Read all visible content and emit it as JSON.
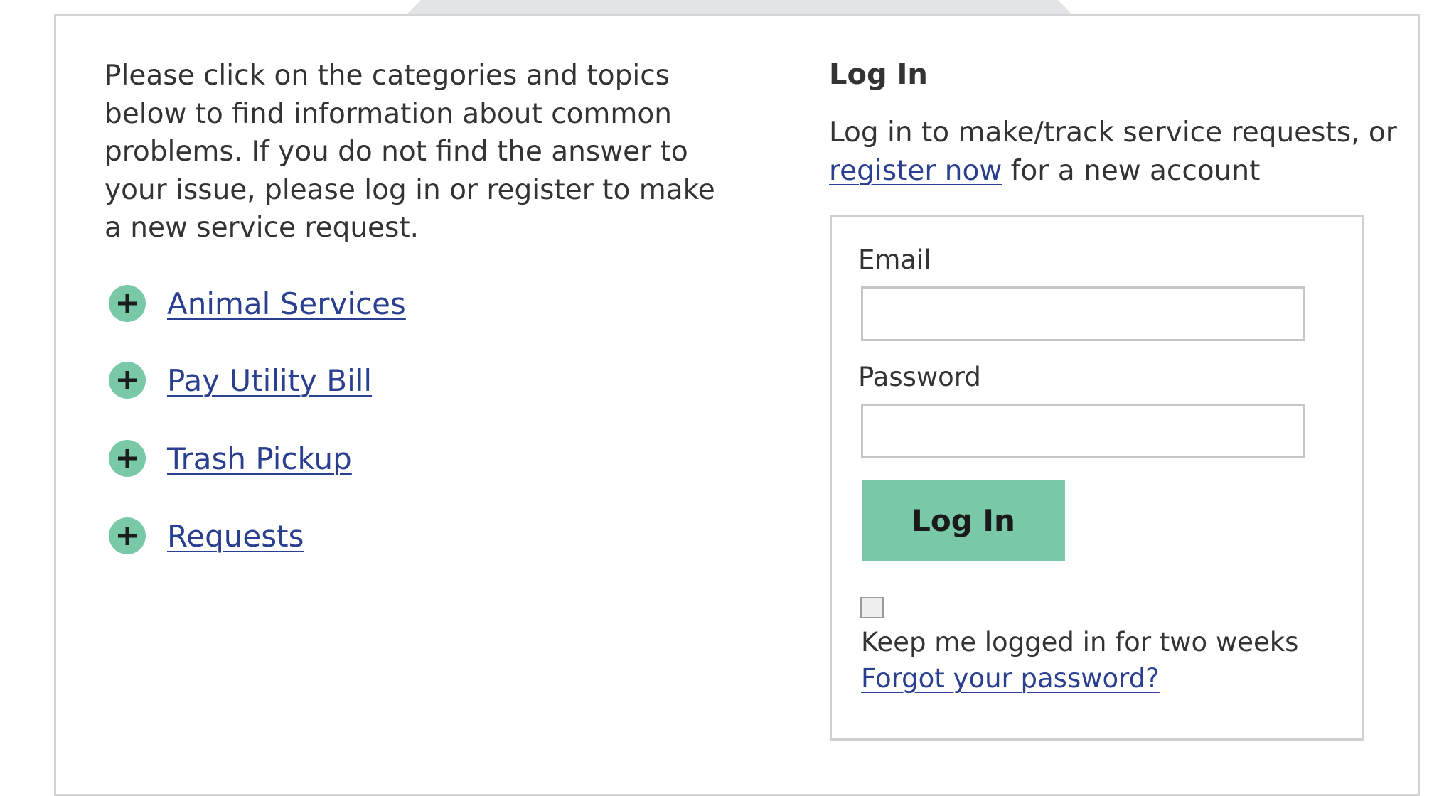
{
  "intro": {
    "text": "Please click on the categories and topics below to find information about common problems. If you do not find the answer to your issue, please log in or register to make a new service request."
  },
  "topics": [
    {
      "label": "Animal Services",
      "icon": "plus-icon"
    },
    {
      "label": "Pay Utility Bill",
      "icon": "plus-icon"
    },
    {
      "label": "Trash Pickup",
      "icon": "plus-icon"
    },
    {
      "label": "Requests",
      "icon": "plus-icon"
    }
  ],
  "login": {
    "title": "Log In",
    "subtitle_before": "Log in to make/track service requests, or ",
    "register_link": "register now",
    "subtitle_after": " for a new account",
    "email_label": "Email",
    "email_value": "",
    "password_label": "Password",
    "password_value": "",
    "button_label": "Log In",
    "remember_label": "Keep me logged in for two weeks",
    "remember_checked": false,
    "forgot_link": "Forgot your password?"
  },
  "colors": {
    "accent": "#79c9a8",
    "link": "#2a3f8f",
    "text": "#333333",
    "border": "#d4d4d4"
  }
}
